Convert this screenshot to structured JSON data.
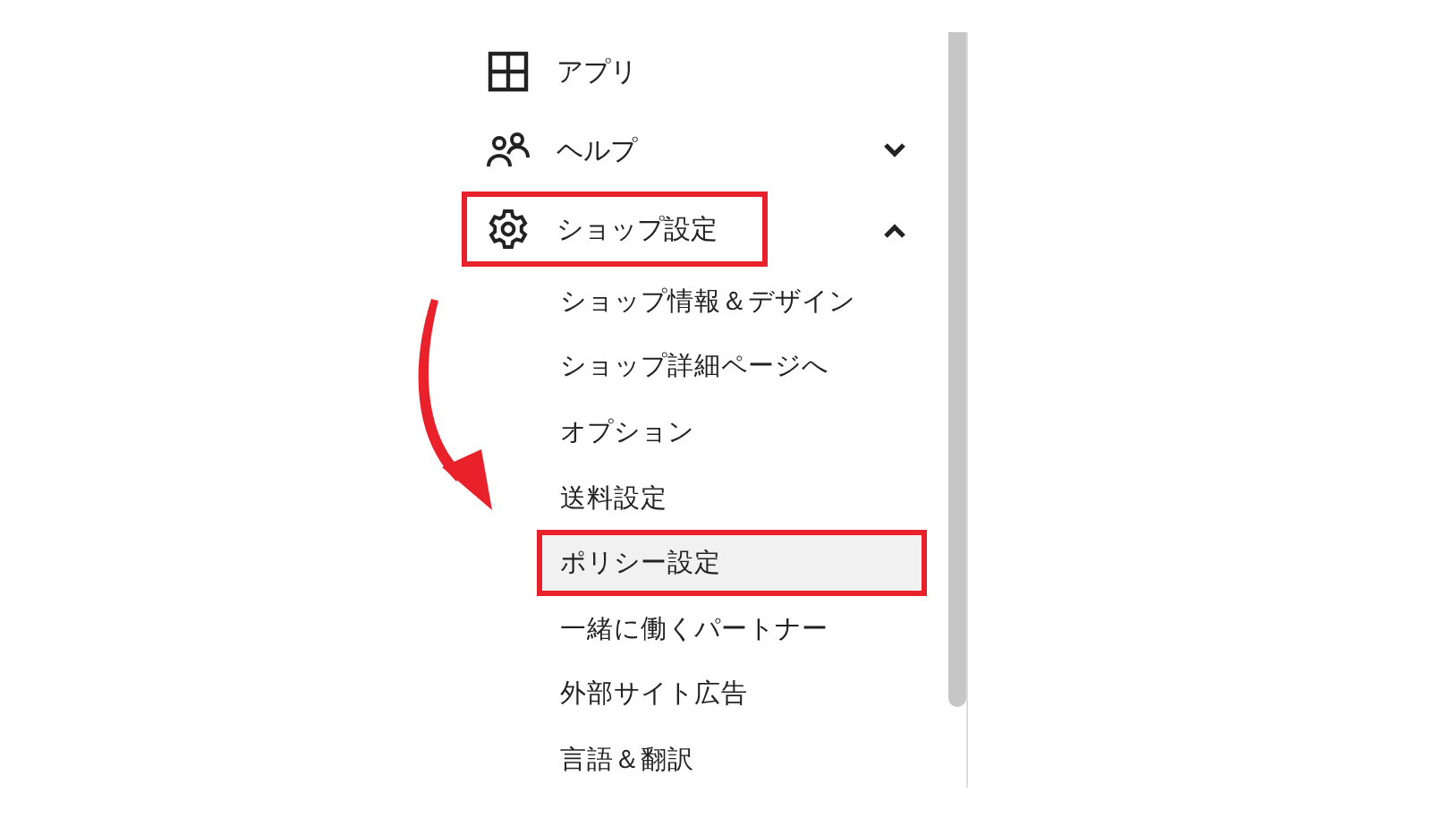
{
  "menu": [
    {
      "label": "アプリ"
    },
    {
      "label": "ヘルプ",
      "expanded": false
    },
    {
      "label": "ショップ設定",
      "expanded": true,
      "annotated": true,
      "children": [
        {
          "label": "ショップ情報＆デザイン",
          "selected": false,
          "annotated": false
        },
        {
          "label": "ショップ詳細ページへ",
          "selected": false,
          "annotated": false
        },
        {
          "label": "オプション",
          "selected": false,
          "annotated": false
        },
        {
          "label": "送料設定",
          "selected": false,
          "annotated": false
        },
        {
          "label": "ポリシー設定",
          "selected": true,
          "annotated": true
        },
        {
          "label": "一緒に働くパートナー",
          "selected": false,
          "annotated": false
        },
        {
          "label": "外部サイト広告",
          "selected": false,
          "annotated": false
        },
        {
          "label": "言語＆翻訳",
          "selected": false,
          "annotated": false
        }
      ]
    }
  ]
}
